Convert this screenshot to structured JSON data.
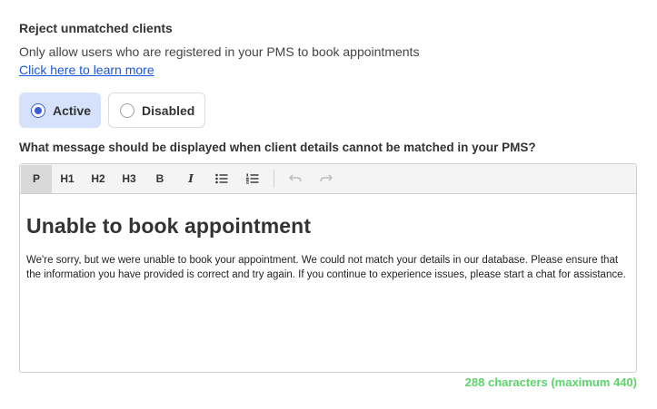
{
  "section": {
    "title": "Reject unmatched clients",
    "description": "Only allow users who are registered in your PMS to book appointments",
    "link": "Click here to learn more"
  },
  "radio": {
    "options": [
      {
        "label": "Active",
        "selected": true
      },
      {
        "label": "Disabled",
        "selected": false
      }
    ]
  },
  "question": "What message should be displayed when client details cannot be matched in your PMS?",
  "editor": {
    "toolbar": {
      "p": "P",
      "h1": "H1",
      "h2": "H2",
      "h3": "H3",
      "bold": "B",
      "italic": "I",
      "bullet_icon": "bullet-list-icon",
      "numbered_icon": "numbered-list-icon",
      "undo_icon": "undo-icon",
      "redo_icon": "redo-icon"
    },
    "heading": "Unable to book appointment",
    "body": "We're sorry, but we were unable to book your appointment. We could not match your details in our database. Please ensure that the information you have provided is correct and try again. If you continue to experience issues, please start a chat for assistance."
  },
  "char_count": "288 characters (maximum 440)",
  "colors": {
    "accent": "#3b5bdb",
    "active_bg": "#d6e2fb",
    "link": "#1a56db",
    "count": "#5dd36b"
  }
}
